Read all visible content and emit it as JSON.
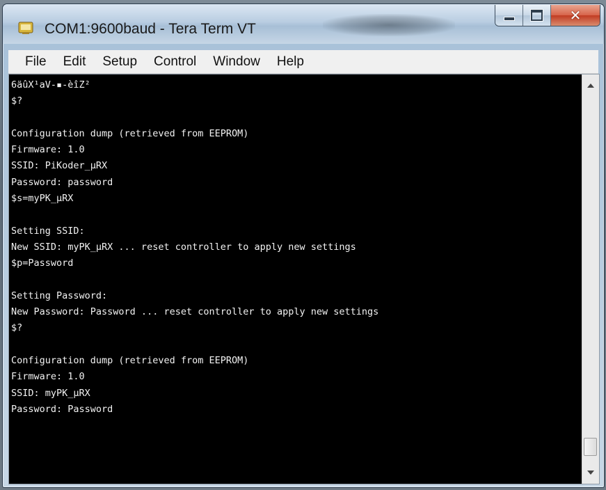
{
  "window": {
    "title": "COM1:9600baud - Tera Term VT",
    "controls": {
      "minimize": "minimize-icon",
      "maximize": "maximize-icon",
      "close": "close-icon"
    }
  },
  "menubar": {
    "items": [
      "File",
      "Edit",
      "Setup",
      "Control",
      "Window",
      "Help"
    ]
  },
  "terminal": {
    "colors": {
      "background": "#000000",
      "foreground": "#f2f2f2"
    },
    "lines": [
      "6äûX¹aV-▪-èîZ²",
      "$?",
      "",
      "Configuration dump (retrieved from EEPROM)",
      "Firmware: 1.0",
      "SSID: PiKoder_µRX",
      "Password: password",
      "$s=myPK_µRX",
      "",
      "Setting SSID:",
      "New SSID: myPK_µRX ... reset controller to apply new settings",
      "$p=Password",
      "",
      "Setting Password:",
      "New Password: Password ... reset controller to apply new settings",
      "$?",
      "",
      "Configuration dump (retrieved from EEPROM)",
      "Firmware: 1.0",
      "SSID: myPK_µRX",
      "Password: Password"
    ]
  }
}
